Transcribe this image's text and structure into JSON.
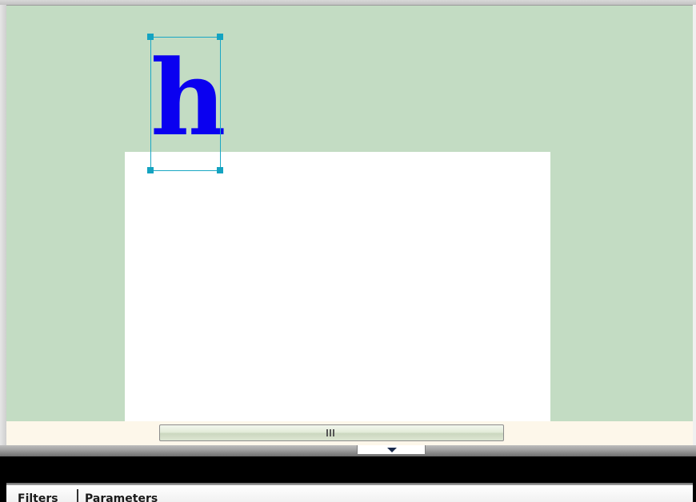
{
  "canvas": {
    "background_color": "#c3dcc3",
    "artboard_color": "#ffffff",
    "text_object": {
      "text": "h",
      "color": "#0a00f0",
      "selected": true,
      "selection_color": "#1aa7c4"
    }
  },
  "scrollbar": {
    "track_color": "#fdf7ea",
    "grip_icon": "grip-lines-icon"
  },
  "divider": {
    "collapse_icon": "triangle-down-icon"
  },
  "bottom_panel": {
    "tabs": [
      {
        "label": "Filters"
      },
      {
        "label": "Parameters"
      }
    ]
  }
}
